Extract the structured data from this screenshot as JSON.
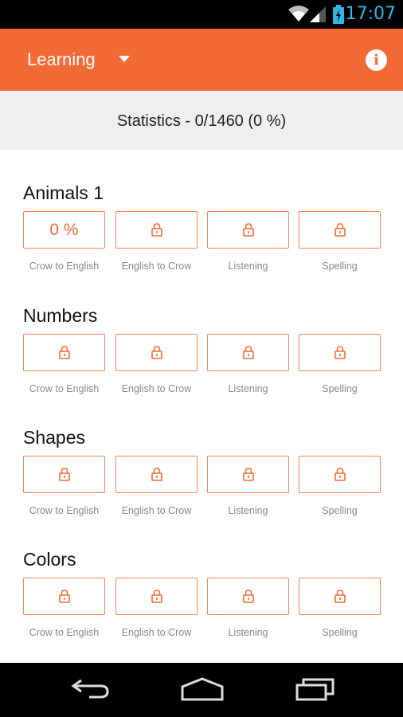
{
  "status_bar": {
    "time": "17:07",
    "icons": [
      "wifi-icon",
      "signal-icon",
      "battery-charging-icon"
    ]
  },
  "app_bar": {
    "title": "Learning",
    "dropdown_icon": "chevron-down-icon",
    "info_icon": "info-icon",
    "info_glyph": "i"
  },
  "stats": {
    "text": "Statistics - 0/1460 (0 %)"
  },
  "sections": [
    {
      "title": "Animals 1",
      "tiles": [
        {
          "label": "Crow to English",
          "state": "progress",
          "value": "0 %"
        },
        {
          "label": "English to Crow",
          "state": "locked"
        },
        {
          "label": "Listening",
          "state": "locked"
        },
        {
          "label": "Spelling",
          "state": "locked"
        }
      ]
    },
    {
      "title": "Numbers",
      "tiles": [
        {
          "label": "Crow to English",
          "state": "locked"
        },
        {
          "label": "English to Crow",
          "state": "locked"
        },
        {
          "label": "Listening",
          "state": "locked"
        },
        {
          "label": "Spelling",
          "state": "locked"
        }
      ]
    },
    {
      "title": "Shapes",
      "tiles": [
        {
          "label": "Crow to English",
          "state": "locked"
        },
        {
          "label": "English to Crow",
          "state": "locked"
        },
        {
          "label": "Listening",
          "state": "locked"
        },
        {
          "label": "Spelling",
          "state": "locked"
        }
      ]
    },
    {
      "title": "Colors",
      "tiles": [
        {
          "label": "Crow to English",
          "state": "locked"
        },
        {
          "label": "English to Crow",
          "state": "locked"
        },
        {
          "label": "Listening",
          "state": "locked"
        },
        {
          "label": "Spelling",
          "state": "locked"
        }
      ]
    }
  ],
  "nav_bar": {
    "buttons": [
      "back-icon",
      "home-icon",
      "recents-icon"
    ]
  },
  "colors": {
    "accent": "#f26a35",
    "tile_border": "#f2845a",
    "stats_bg": "#efefef",
    "status_text": "#33b5e5"
  }
}
